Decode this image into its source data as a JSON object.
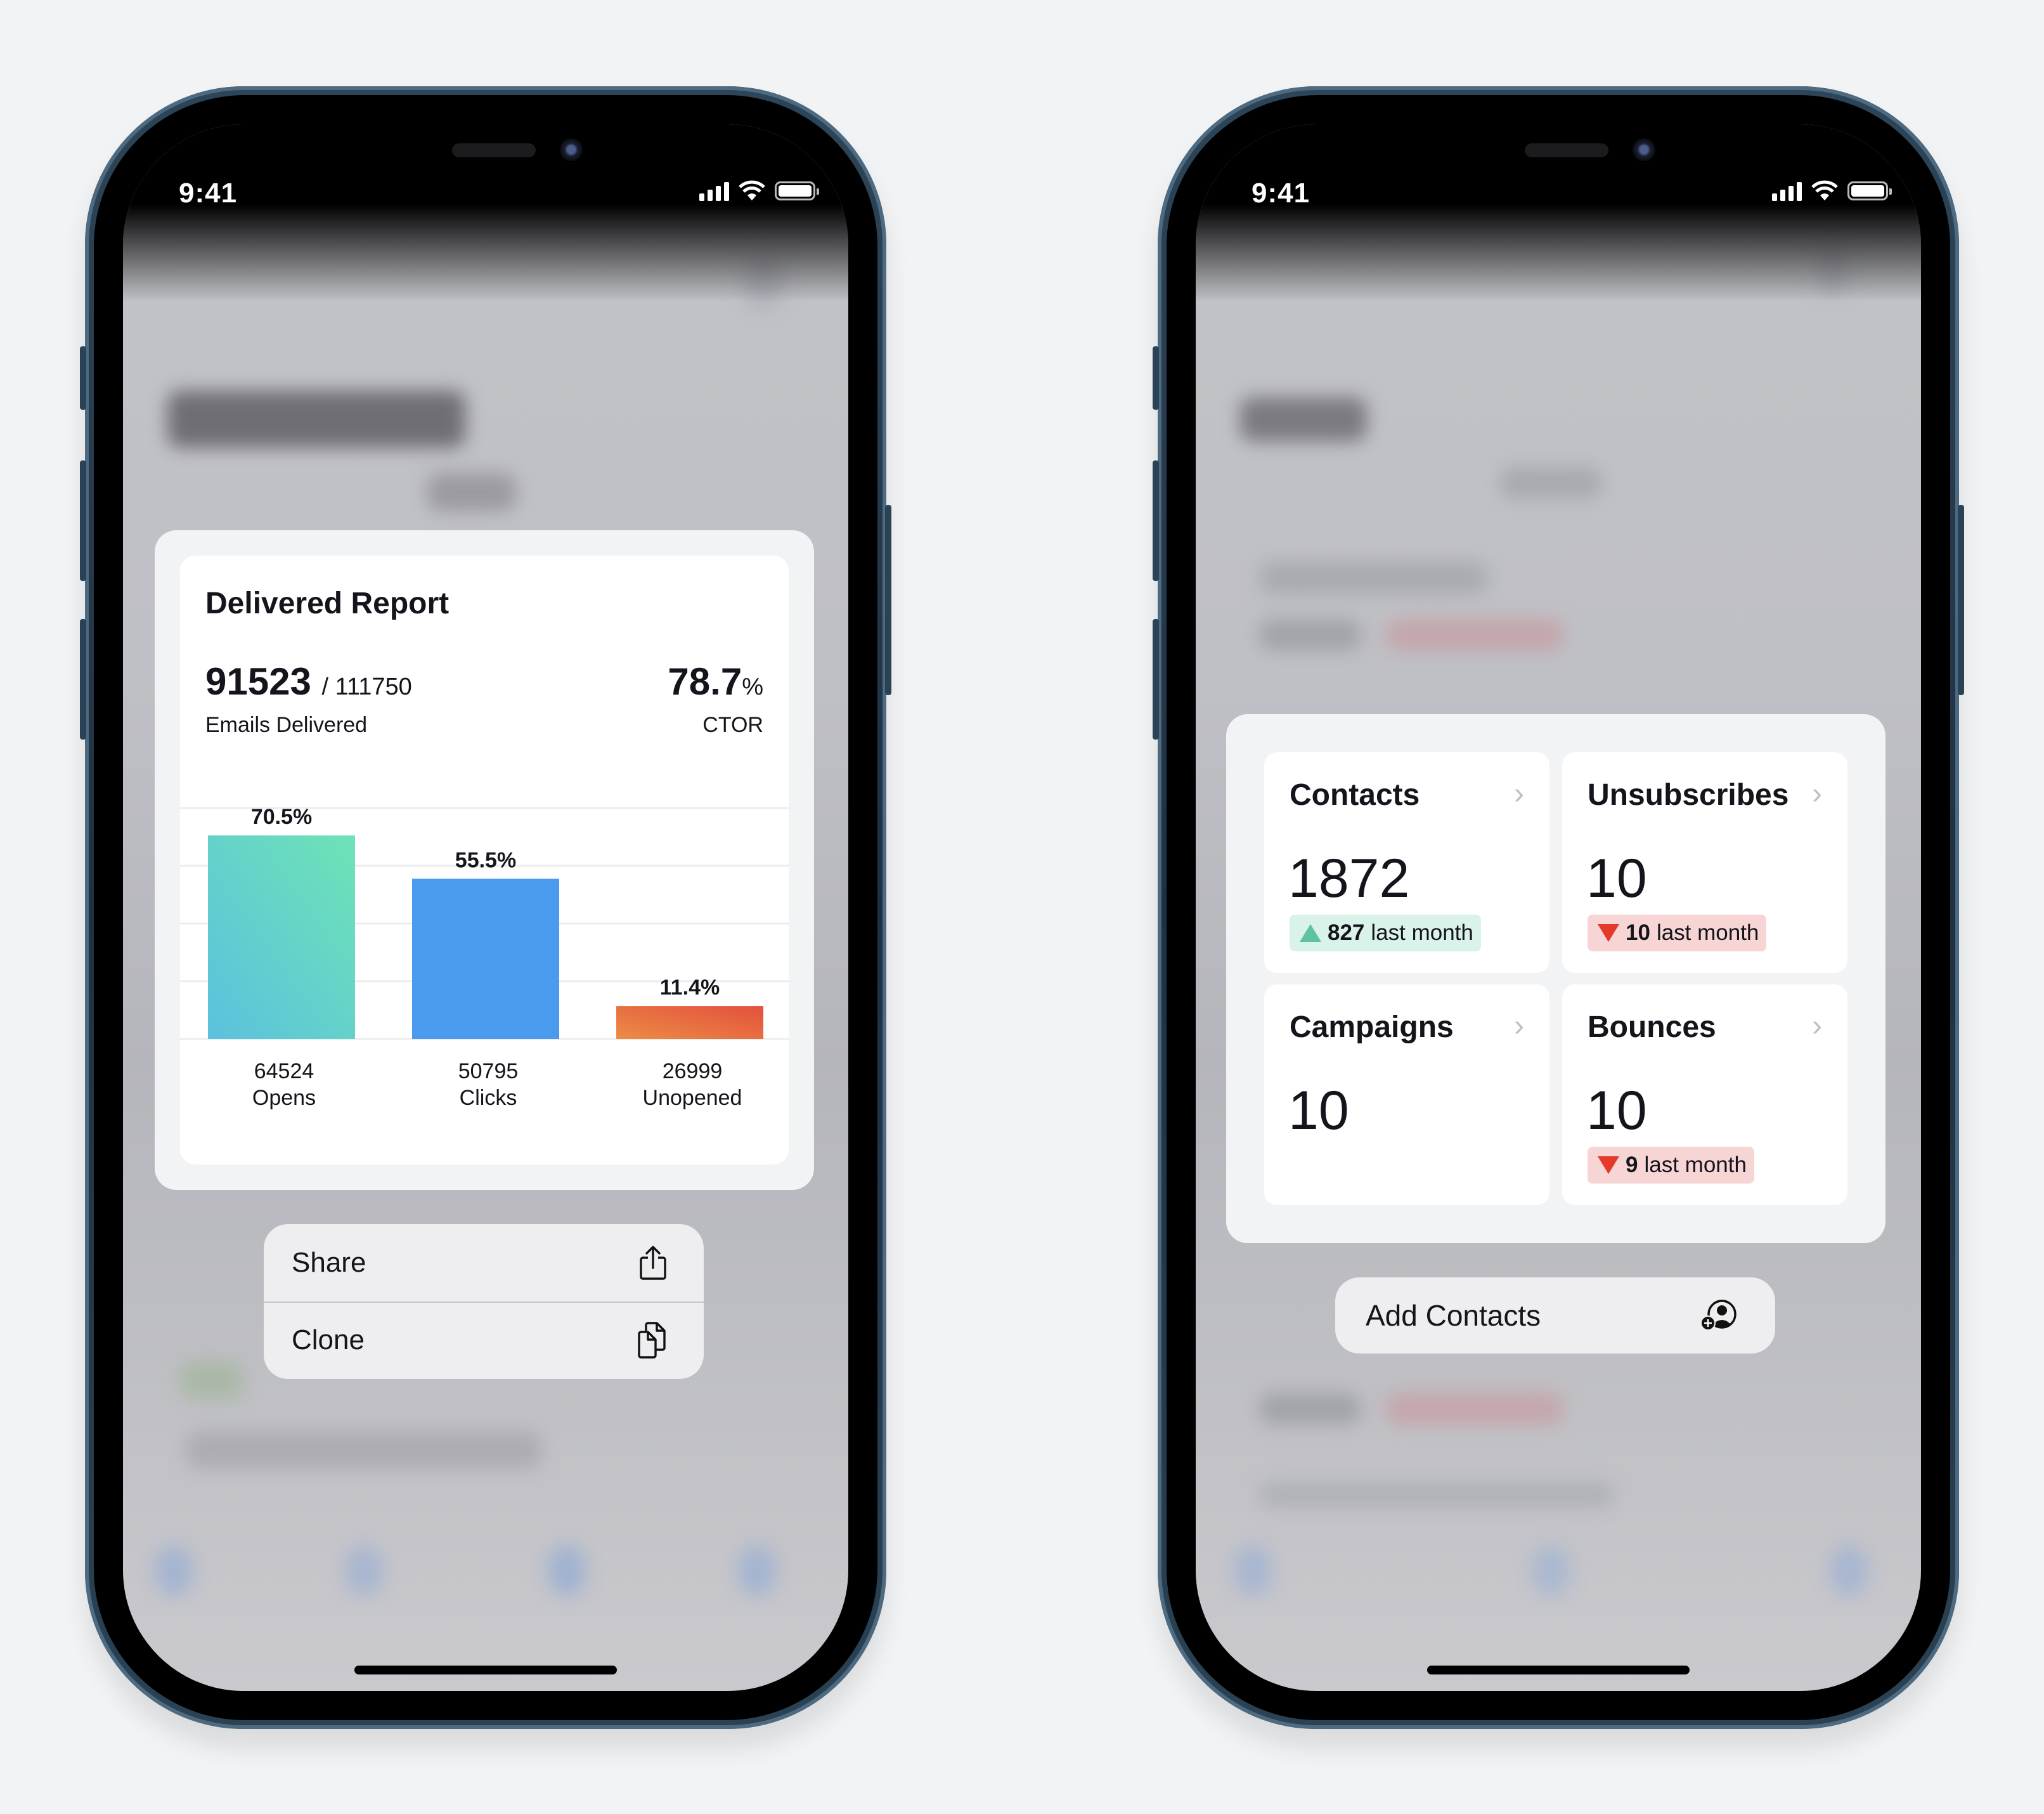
{
  "left_phone": {
    "status_bar": {
      "time": "9:41",
      "icons": [
        "cellular-signal-icon",
        "wifi-icon",
        "battery-icon"
      ]
    },
    "report": {
      "title": "Delivered Report",
      "emails_delivered": "91523",
      "emails_total": "/ 111750",
      "emails_label": "Emails Delivered",
      "ctor_value": "78.7",
      "ctor_unit": "%",
      "ctor_label": "CTOR"
    },
    "context_menu": [
      {
        "label": "Share",
        "icon": "share-icon"
      },
      {
        "label": "Clone",
        "icon": "copy-icon"
      }
    ]
  },
  "right_phone": {
    "status_bar": {
      "time": "9:41",
      "icons": [
        "cellular-signal-icon",
        "wifi-icon",
        "battery-icon"
      ]
    },
    "stats": [
      {
        "title": "Contacts",
        "value": "1872",
        "badge": {
          "direction": "up",
          "amount": "827",
          "text": "last month"
        }
      },
      {
        "title": "Unsubscribes",
        "value": "10",
        "badge": {
          "direction": "down",
          "amount": "10",
          "text": "last month"
        }
      },
      {
        "title": "Campaigns",
        "value": "10"
      },
      {
        "title": "Bounces",
        "value": "10",
        "badge": {
          "direction": "down",
          "amount": "9",
          "text": "last month"
        }
      }
    ],
    "chevron": "›",
    "add_contacts_label": "Add Contacts"
  },
  "colors": {
    "opens_gradient": [
      "#5bc1de",
      "#6ee3b6"
    ],
    "clicks": "#4a9bed",
    "unopened_gradient": [
      "#ec8c45",
      "#e3503d"
    ],
    "up": "#5ec39e",
    "down": "#e5392c"
  },
  "chart_data": {
    "type": "bar",
    "title": "Delivered Report",
    "categories": [
      "Opens",
      "Clicks",
      "Unopened"
    ],
    "values": [
      64524,
      50795,
      26999
    ],
    "percent_labels": [
      "70.5%",
      "55.5%",
      "11.4%"
    ],
    "percents": [
      70.5,
      55.5,
      11.4
    ],
    "count_labels": [
      "64524",
      "50795",
      "26999"
    ],
    "ylim": [
      0,
      80
    ],
    "grid": true,
    "xlabel": "",
    "ylabel": ""
  }
}
